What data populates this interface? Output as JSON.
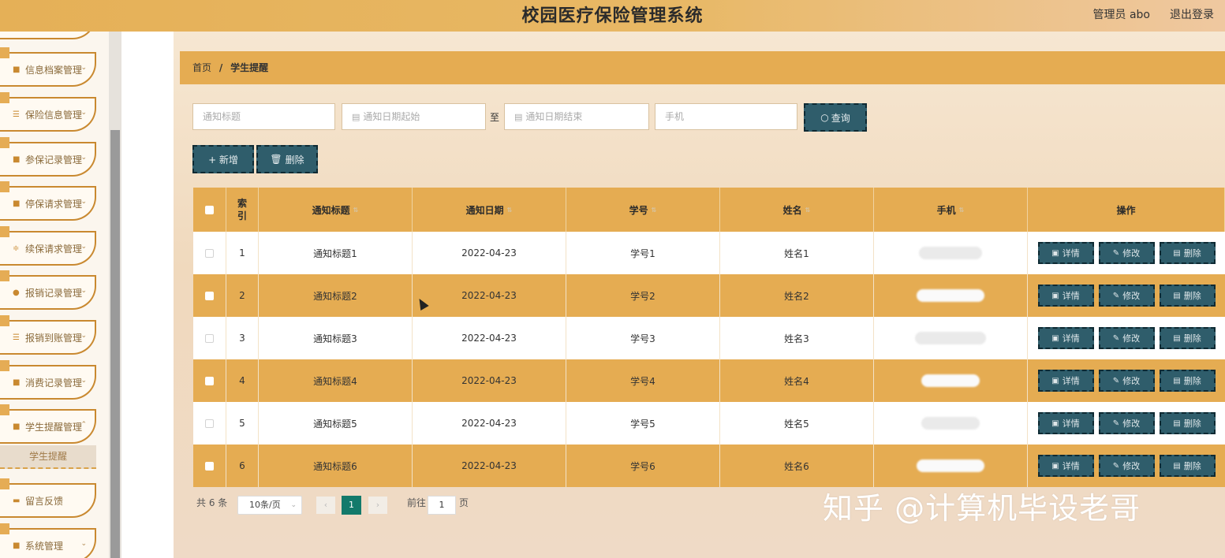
{
  "header": {
    "title": "校园医疗保险管理系统",
    "user_label": "管理员 abo",
    "logout_label": "退出登录"
  },
  "sidebar": {
    "items": [
      {
        "label": "信息档案管理",
        "icon": "grid-icon"
      },
      {
        "label": "保险信息管理",
        "icon": "list-icon"
      },
      {
        "label": "参保记录管理",
        "icon": "grid-icon"
      },
      {
        "label": "停保请求管理",
        "icon": "grid-icon"
      },
      {
        "label": "续保请求管理",
        "icon": "sliders-icon"
      },
      {
        "label": "报销记录管理",
        "icon": "pin-icon"
      },
      {
        "label": "报销到账管理",
        "icon": "list-icon"
      },
      {
        "label": "消费记录管理",
        "icon": "grid-icon"
      },
      {
        "label": "学生提醒管理",
        "icon": "grid-icon"
      },
      {
        "label": "留言反馈",
        "icon": "briefcase-icon"
      },
      {
        "label": "系统管理",
        "icon": "grid-icon"
      }
    ],
    "active_sub": "学生提醒"
  },
  "breadcrumb": {
    "home": "首页",
    "separator": "/",
    "current": "学生提醒"
  },
  "search": {
    "title_placeholder": "通知标题",
    "date_start_placeholder": "通知日期起始",
    "to_label": "至",
    "date_end_placeholder": "通知日期结束",
    "phone_placeholder": "手机",
    "query_label": "查询"
  },
  "toolbar": {
    "add_label": "+ 新增",
    "delete_label": "删除"
  },
  "table": {
    "columns": [
      "索引",
      "通知标题",
      "通知日期",
      "学号",
      "姓名",
      "手机",
      "操作"
    ],
    "rows": [
      {
        "index": "1",
        "title": "通知标题1",
        "date": "2022-04-23",
        "sid": "学号1",
        "name": "姓名1"
      },
      {
        "index": "2",
        "title": "通知标题2",
        "date": "2022-04-23",
        "sid": "学号2",
        "name": "姓名2"
      },
      {
        "index": "3",
        "title": "通知标题3",
        "date": "2022-04-23",
        "sid": "学号3",
        "name": "姓名3"
      },
      {
        "index": "4",
        "title": "通知标题4",
        "date": "2022-04-23",
        "sid": "学号4",
        "name": "姓名4"
      },
      {
        "index": "5",
        "title": "通知标题5",
        "date": "2022-04-23",
        "sid": "学号5",
        "name": "姓名5"
      },
      {
        "index": "6",
        "title": "通知标题6",
        "date": "2022-04-23",
        "sid": "学号6",
        "name": "姓名6"
      }
    ],
    "actions": {
      "detail": "详情",
      "edit": "修改",
      "delete": "删除"
    }
  },
  "pagination": {
    "total": "共 6 条",
    "page_size": "10条/页",
    "current_page": "1",
    "goto_label": "前往",
    "goto_value": "1",
    "page_suffix": "页"
  },
  "watermark": "知乎 @计算机毕设老哥",
  "colors": {
    "accent": "#e5ac52",
    "button_dark": "#2f5d6b",
    "pager_active": "#137a6b"
  }
}
